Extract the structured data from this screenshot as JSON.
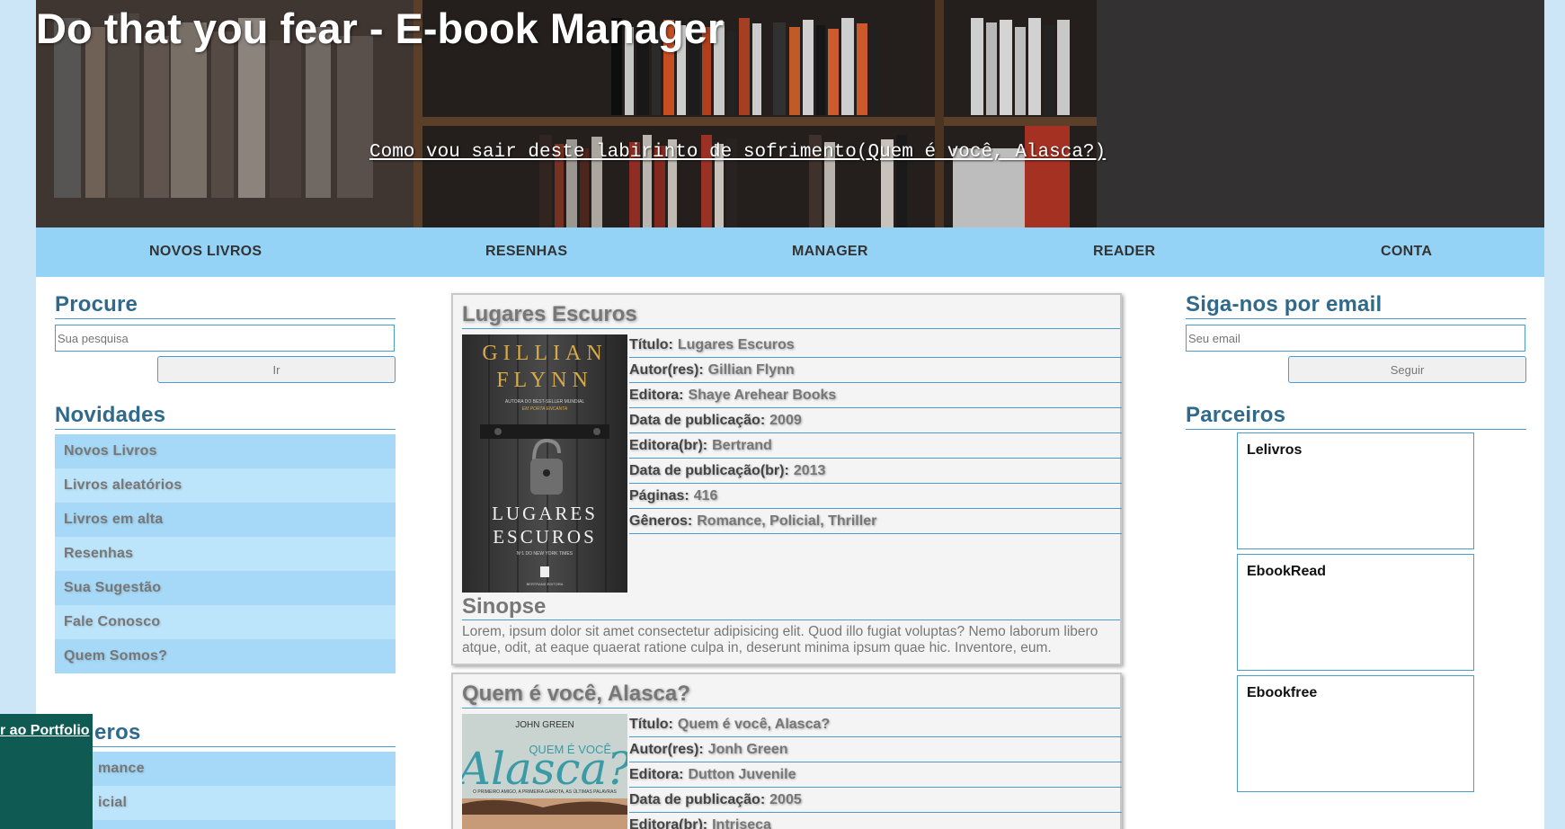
{
  "header": {
    "title": "Do that you fear - E-book Manager",
    "quote": "Como vou sair deste labirinto de sofrimento(Quem é você, Alasca?)"
  },
  "nav": {
    "items": [
      "NOVOS LIVROS",
      "RESENHAS",
      "MANAGER",
      "READER",
      "CONTA"
    ]
  },
  "left": {
    "search_title": "Procure",
    "search_placeholder": "Sua pesquisa",
    "search_button": "Ir",
    "novidades_title": "Novidades",
    "novidades": [
      "Novos Livros",
      "Livros aleatórios",
      "Livros em alta",
      "Resenhas",
      "Sua Sugestão",
      "Fale Conosco",
      "Quem Somos?"
    ],
    "generos_title": "Gêneros",
    "generos_visible_title": "eros",
    "generos": [
      "Romance",
      "Policial"
    ],
    "generos_visible": [
      "mance",
      "icial"
    ]
  },
  "posts": [
    {
      "title": "Lugares Escuros",
      "fields": [
        {
          "k": "Título:",
          "v": "Lugares Escuros"
        },
        {
          "k": "Autor(res):",
          "v": "Gillian Flynn"
        },
        {
          "k": "Editora:",
          "v": "Shaye Arehear Books"
        },
        {
          "k": "Data de publicação:",
          "v": "2009"
        },
        {
          "k": "Editora(br):",
          "v": "Bertrand"
        },
        {
          "k": "Data de publicação(br):",
          "v": "2013"
        },
        {
          "k": "Páginas:",
          "v": "416"
        },
        {
          "k": "Gêneros:",
          "v": "Romance, Policial, Thriller"
        }
      ],
      "cover": {
        "author_line1": "GILLIAN",
        "author_line2": "FLYNN",
        "tagline": "AUTORA DO BEST-SELLER MUNDIAL",
        "tagline2": "EM PORTA ENCANTA",
        "title1": "LUGARES",
        "title2": "ESCUROS",
        "sub": "Nº1 DO NEW YORK TIMES",
        "publisher": "BERTRAND EDITORA"
      },
      "sinopse_title": "Sinopse",
      "sinopse": "Lorem, ipsum dolor sit amet consectetur adipisicing elit. Quod illo fugiat voluptas? Nemo laborum libero atque, odit, at eaque quaerat ratione culpa in, deserunt minima ipsum quae hic. Inventore, eum."
    },
    {
      "title": "Quem é você, Alasca?",
      "fields": [
        {
          "k": "Título:",
          "v": "Quem é você, Alasca?"
        },
        {
          "k": "Autor(res):",
          "v": "Jonh Green"
        },
        {
          "k": "Editora:",
          "v": "Dutton Juvenile"
        },
        {
          "k": "Data de publicação:",
          "v": "2005"
        },
        {
          "k": "Editora(br):",
          "v": "Intriseca"
        }
      ],
      "cover": {
        "author": "JOHN GREEN",
        "title_small": "QUEM É VOCÊ,",
        "title_big": "Alasca?",
        "tagline": "O PRIMEIRO AMIGO, A PRIMEIRA GAROTA, AS ÚLTIMAS PALAVRAS"
      }
    }
  ],
  "right": {
    "email_title": "Siga-nos por email",
    "email_placeholder": "Seu email",
    "email_button": "Seguir",
    "partners_title": "Parceiros",
    "partners": [
      "Lelivros",
      "EbookRead",
      "Ebookfree"
    ]
  },
  "portfolio": {
    "label": "Voltar ao Portfolio",
    "visible_label": "r ao Portfolio"
  }
}
